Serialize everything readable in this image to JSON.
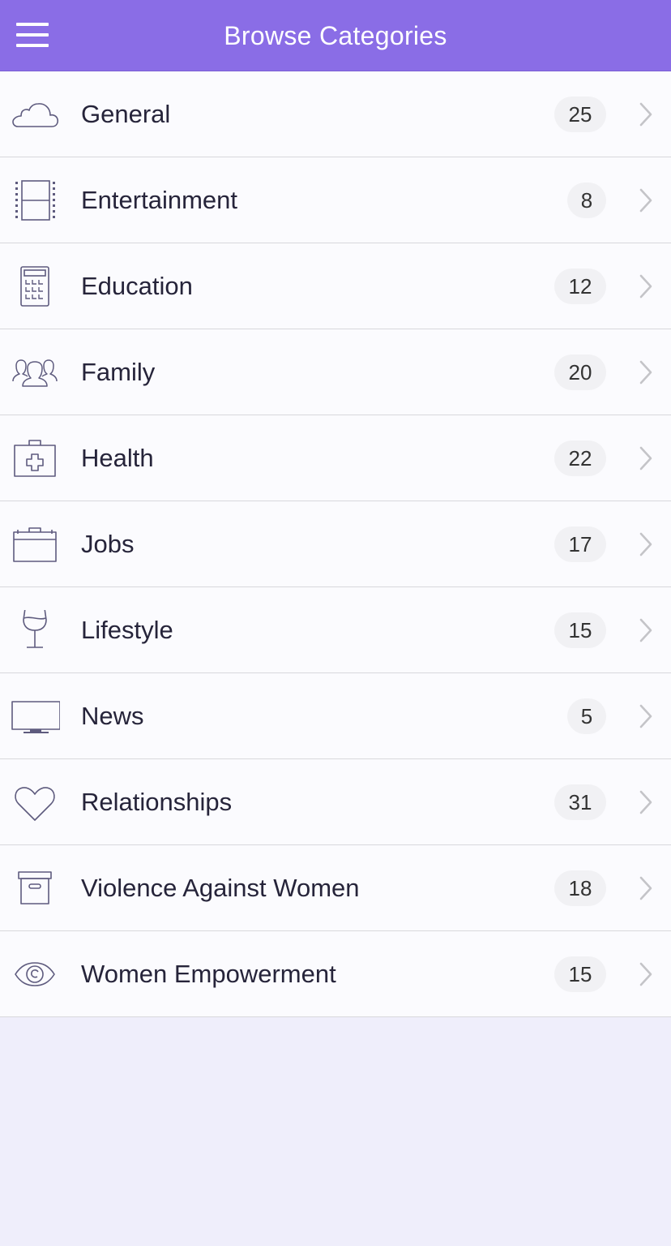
{
  "header": {
    "title": "Browse Categories",
    "menu_icon": "hamburger-menu-icon"
  },
  "colors": {
    "header_bg": "#8a6de6",
    "icon_stroke": "#5e5b7e",
    "background": "#efeefb"
  },
  "categories": [
    {
      "label": "General",
      "count": "25",
      "icon": "cloud-icon"
    },
    {
      "label": "Entertainment",
      "count": "8",
      "icon": "film-strip-icon"
    },
    {
      "label": "Education",
      "count": "12",
      "icon": "calculator-icon"
    },
    {
      "label": "Family",
      "count": "20",
      "icon": "people-group-icon"
    },
    {
      "label": "Health",
      "count": "22",
      "icon": "first-aid-kit-icon"
    },
    {
      "label": "Jobs",
      "count": "17",
      "icon": "briefcase-icon"
    },
    {
      "label": "Lifestyle",
      "count": "15",
      "icon": "wine-glass-icon"
    },
    {
      "label": "News",
      "count": "5",
      "icon": "monitor-icon"
    },
    {
      "label": "Relationships",
      "count": "31",
      "icon": "heart-icon"
    },
    {
      "label": "Violence Against Women",
      "count": "18",
      "icon": "archive-box-icon"
    },
    {
      "label": "Women Empowerment",
      "count": "15",
      "icon": "eye-icon"
    }
  ]
}
